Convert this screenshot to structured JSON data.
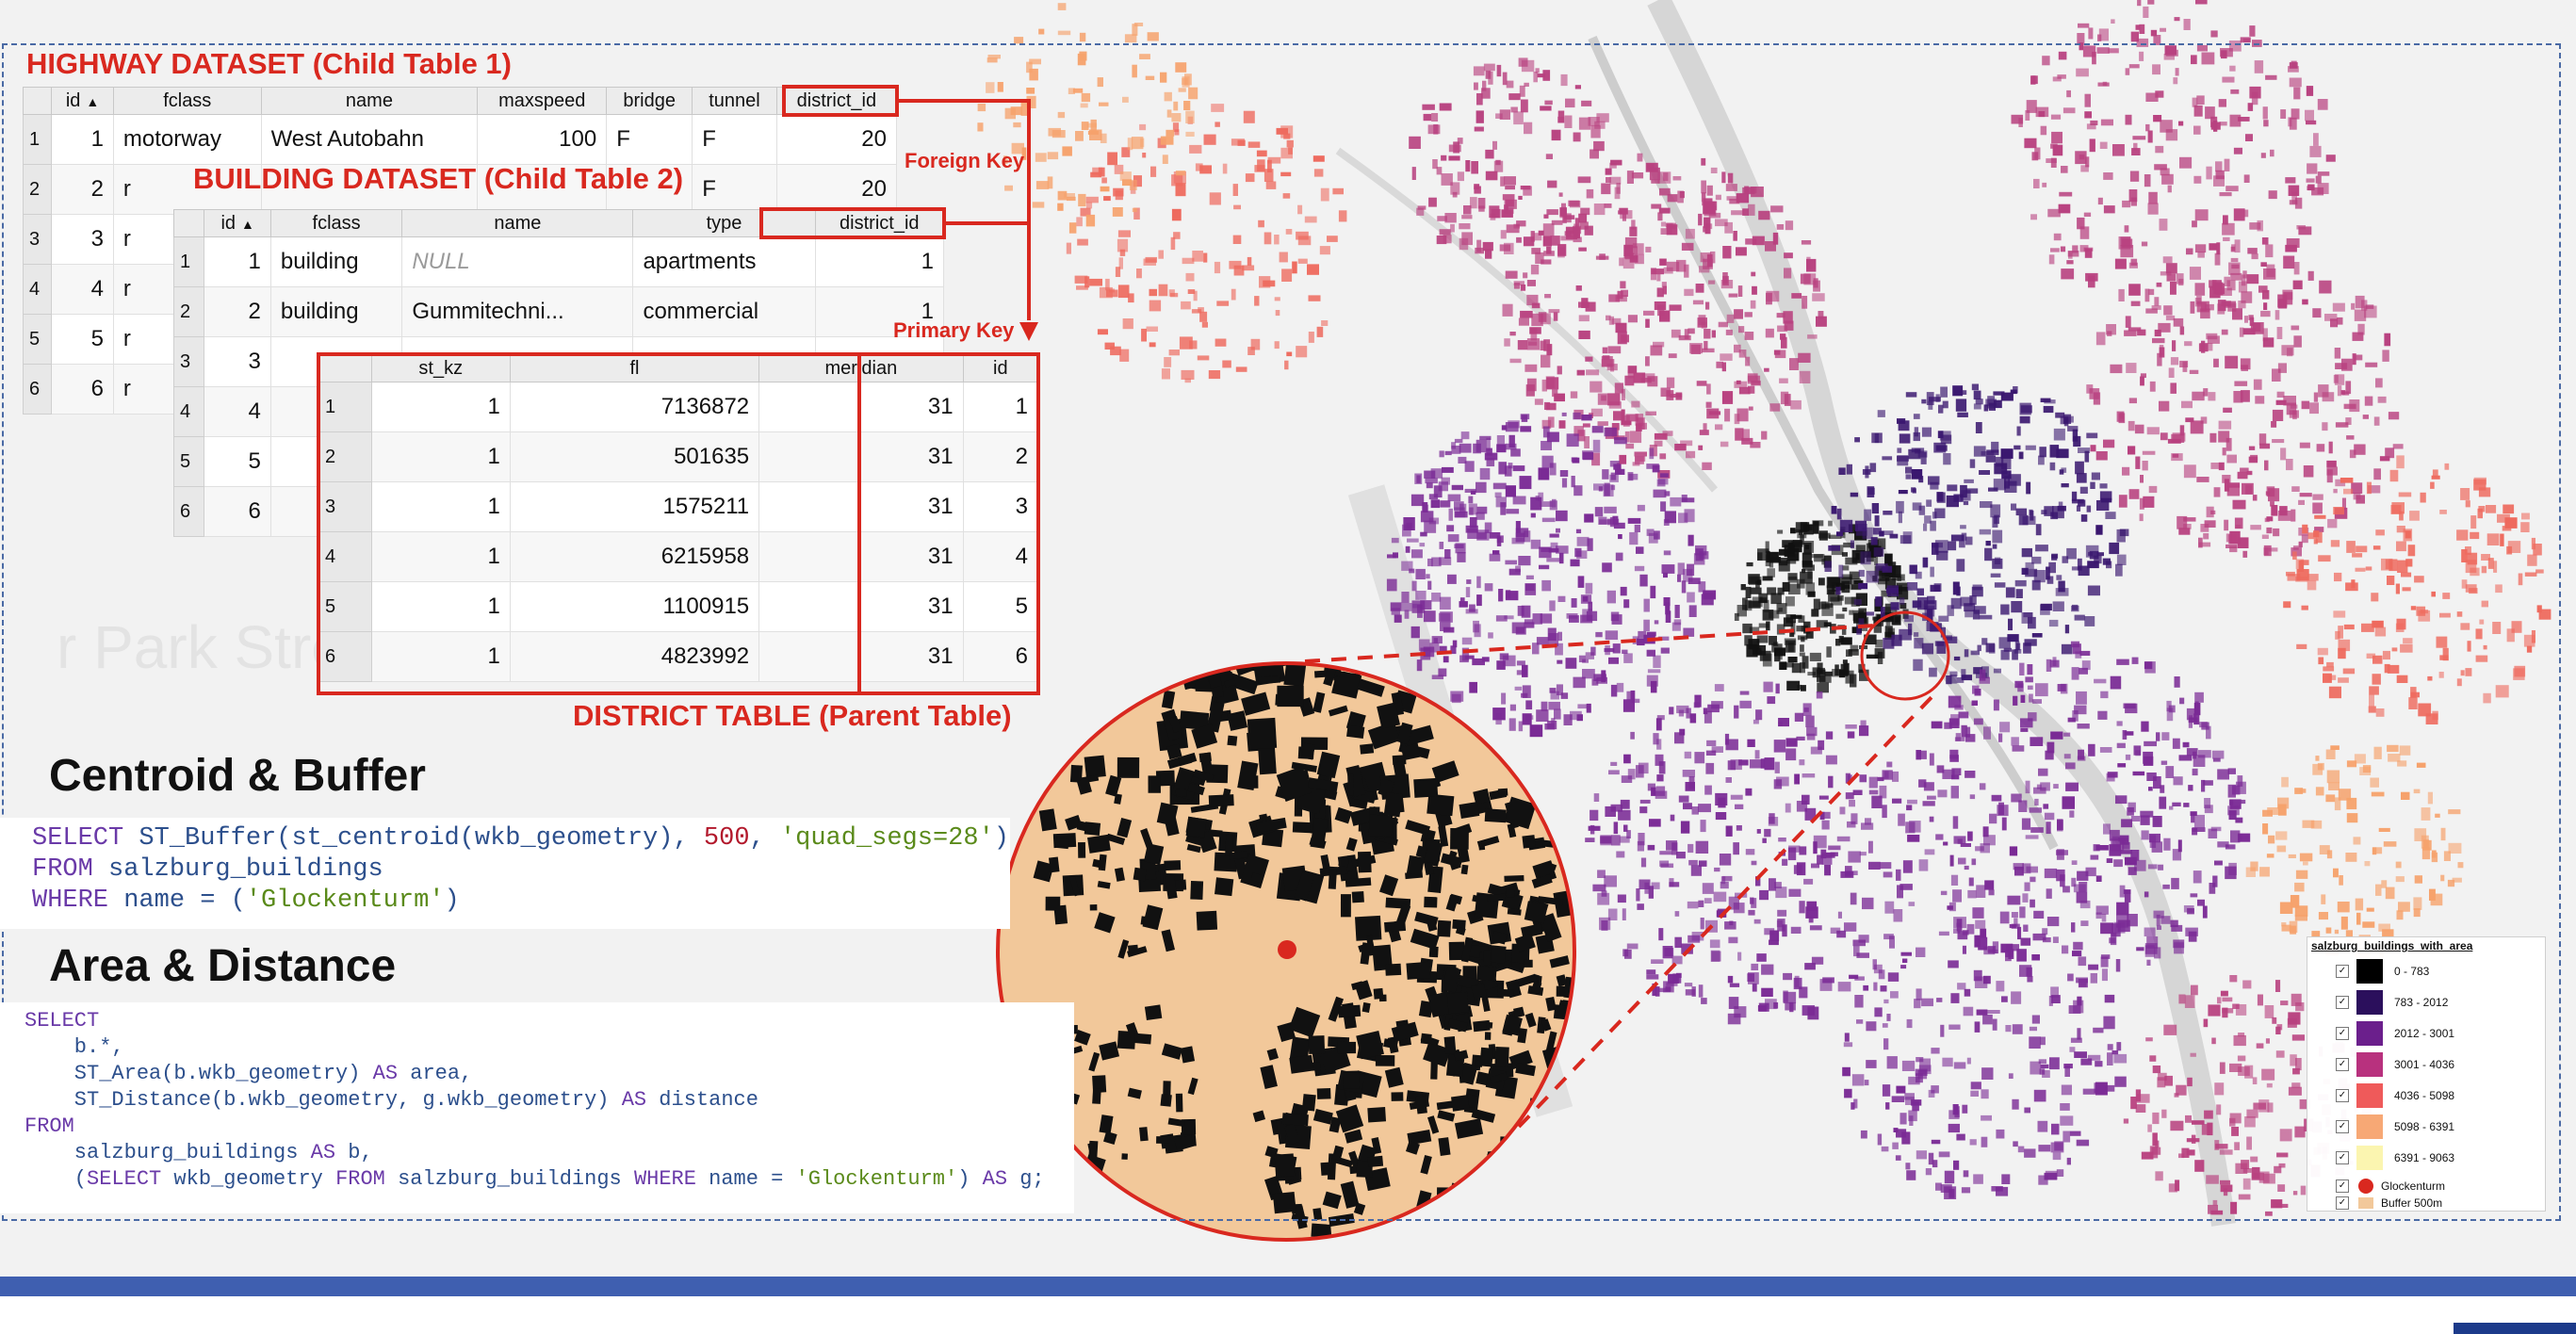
{
  "highway": {
    "title": "HIGHWAY DATASET (Child Table 1)",
    "columns": [
      "id",
      "fclass",
      "name",
      "maxspeed",
      "bridge",
      "tunnel",
      "district_id"
    ],
    "rows": [
      {
        "rh": "1",
        "id": "1",
        "fclass": "motorway",
        "name": "West Autobahn",
        "maxspeed": "100",
        "bridge": "F",
        "tunnel": "F",
        "district_id": "20"
      },
      {
        "rh": "2",
        "id": "2",
        "fclass": "r",
        "name": "",
        "maxspeed": "",
        "bridge": "",
        "tunnel": "F",
        "district_id": "20"
      },
      {
        "rh": "3",
        "id": "3",
        "fclass": "r",
        "name": "",
        "maxspeed": "",
        "bridge": "",
        "tunnel": "",
        "district_id": ""
      },
      {
        "rh": "4",
        "id": "4",
        "fclass": "r",
        "name": "",
        "maxspeed": "",
        "bridge": "",
        "tunnel": "",
        "district_id": ""
      },
      {
        "rh": "5",
        "id": "5",
        "fclass": "r",
        "name": "",
        "maxspeed": "",
        "bridge": "",
        "tunnel": "",
        "district_id": ""
      },
      {
        "rh": "6",
        "id": "6",
        "fclass": "r",
        "name": "",
        "maxspeed": "",
        "bridge": "",
        "tunnel": "",
        "district_id": ""
      }
    ]
  },
  "building": {
    "title": "BUILDING DATASET (Child Table 2)",
    "columns": [
      "id",
      "fclass",
      "name",
      "type",
      "district_id"
    ],
    "rows": [
      {
        "rh": "1",
        "id": "1",
        "fclass": "building",
        "name": "NULL",
        "type": "apartments",
        "district_id": "1"
      },
      {
        "rh": "2",
        "id": "2",
        "fclass": "building",
        "name": "Gummitechni...",
        "type": "commercial",
        "district_id": "1"
      },
      {
        "rh": "3",
        "id": "3",
        "fclass": "",
        "name": "",
        "type": "",
        "district_id": ""
      },
      {
        "rh": "4",
        "id": "4",
        "fclass": "",
        "name": "",
        "type": "",
        "district_id": ""
      },
      {
        "rh": "5",
        "id": "5",
        "fclass": "",
        "name": "",
        "type": "",
        "district_id": ""
      },
      {
        "rh": "6",
        "id": "6",
        "fclass": "",
        "name": "",
        "type": "",
        "district_id": ""
      }
    ]
  },
  "district": {
    "title": "DISTRICT TABLE (Parent Table)",
    "columns": [
      "st_kz",
      "fl",
      "meridian",
      "id"
    ],
    "rows": [
      {
        "rh": "1",
        "st_kz": "1",
        "fl": "7136872",
        "meridian": "31",
        "id": "1"
      },
      {
        "rh": "2",
        "st_kz": "1",
        "fl": "501635",
        "meridian": "31",
        "id": "2"
      },
      {
        "rh": "3",
        "st_kz": "1",
        "fl": "1575211",
        "meridian": "31",
        "id": "3"
      },
      {
        "rh": "4",
        "st_kz": "1",
        "fl": "6215958",
        "meridian": "31",
        "id": "4"
      },
      {
        "rh": "5",
        "st_kz": "1",
        "fl": "1100915",
        "meridian": "31",
        "id": "5"
      },
      {
        "rh": "6",
        "st_kz": "1",
        "fl": "4823992",
        "meridian": "31",
        "id": "6"
      }
    ]
  },
  "annotations": {
    "foreign_key": "Foreign Key",
    "primary_key": "Primary Key"
  },
  "sections": {
    "centroid_heading": "Centroid & Buffer",
    "area_heading": "Area & Distance"
  },
  "code1": {
    "line1_select": "SELECT",
    "line1_fn": " ST_Buffer(st_centroid(wkb_geometry), ",
    "line1_num": "500",
    "line1_sep": ", ",
    "line1_str": "'quad_segs=28'",
    "line1_end": ")",
    "line2_kw": "FROM",
    "line2_rest": " salzburg_buildings",
    "line3_kw": "WHERE",
    "line3_rest": " name = (",
    "line3_str": "'Glockenturm'",
    "line3_end": ")"
  },
  "code2": {
    "l1": "SELECT",
    "l2": "    b.*,",
    "l3a": "    ST_Area(b.wkb_geometry) ",
    "l3b": "AS",
    "l3c": " area,",
    "l4a": "    ST_Distance(b.wkb_geometry, g.wkb_geometry) ",
    "l4b": "AS",
    "l4c": " distance",
    "l5": "FROM",
    "l6a": "    salzburg_buildings ",
    "l6b": "AS",
    "l6c": " b,",
    "l7a": "    (",
    "l7b": "SELECT",
    "l7c": " wkb_geometry ",
    "l7d": "FROM",
    "l7e": " salzburg_buildings ",
    "l7f": "WHERE",
    "l7g": " name = ",
    "l7h": "'Glockenturm'",
    "l7i": ") ",
    "l7j": "AS",
    "l7k": " g;"
  },
  "legend": {
    "title": "salzburg_buildings_with_area",
    "classes": [
      {
        "label": "0 - 783",
        "color": "#000000"
      },
      {
        "label": "783 - 2012",
        "color": "#2b0f5c"
      },
      {
        "label": "2012 - 3001",
        "color": "#6b1f8c"
      },
      {
        "label": "3001 - 4036",
        "color": "#b8317e"
      },
      {
        "label": "4036 - 5098",
        "color": "#ef5a5a"
      },
      {
        "label": "5098 - 6391",
        "color": "#f7a875"
      },
      {
        "label": "6391 - 9063",
        "color": "#fbf5b0"
      }
    ],
    "glockenturm": "Glockenturm",
    "buffer": "Buffer 500m",
    "check": "✓"
  },
  "map": {
    "watermark": "r Park Stre",
    "colors": {
      "dark": "#111111",
      "purple_dark": "#3a176f",
      "purple": "#7a2a95",
      "magenta": "#b8417f",
      "coral": "#ee6a5e",
      "orange": "#f6a26c",
      "buffer_fill": "#f2c89a",
      "accent_red": "#d9281f"
    }
  }
}
